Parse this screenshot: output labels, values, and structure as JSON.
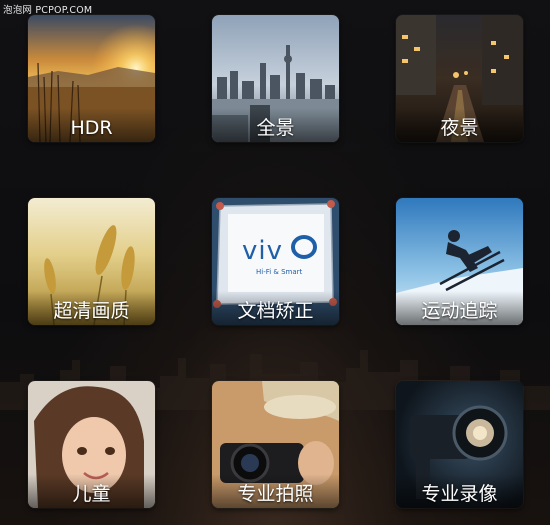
{
  "watermark": "泡泡网 PCPOP.COM",
  "modes": [
    {
      "label": "HDR"
    },
    {
      "label": "全景"
    },
    {
      "label": "夜景"
    },
    {
      "label": "超清画质"
    },
    {
      "label": "文档矫正",
      "doc_logo": "viv",
      "doc_tagline": "Hi-Fi & Smart"
    },
    {
      "label": "运动追踪"
    },
    {
      "label": "儿童"
    },
    {
      "label": "专业拍照"
    },
    {
      "label": "专业录像"
    }
  ]
}
